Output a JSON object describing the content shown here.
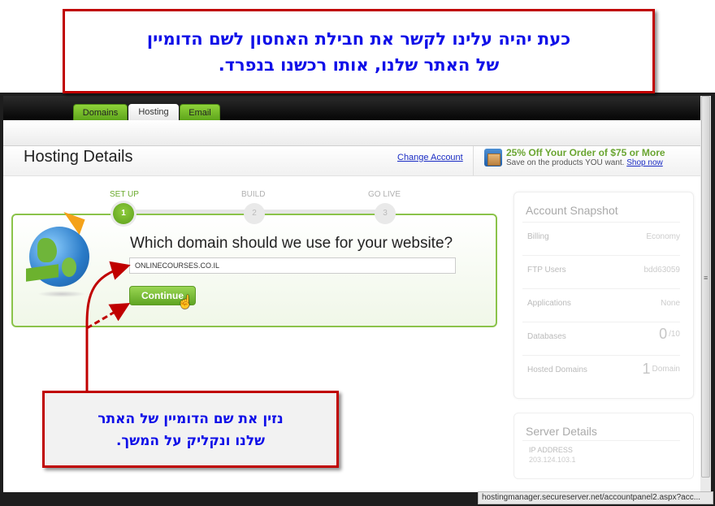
{
  "annotations": {
    "top_callout": [
      "כעת יהיה עלינו לקשר את חבילת האחסון לשם הדומיין",
      "של האתר שלנו, אותו רכשנו בנפרד."
    ],
    "bottom_callout": [
      "נזין את שם הדומיין של האתר",
      "שלנו ונקליק על המשך."
    ],
    "arrow_color": "#c00000",
    "text_color": "#1010e8"
  },
  "nav": {
    "tabs": [
      {
        "label": "Domains",
        "active": false
      },
      {
        "label": "Hosting",
        "active": true
      },
      {
        "label": "Email",
        "active": false
      }
    ]
  },
  "header": {
    "title": "Hosting Details",
    "change_account": "Change Account",
    "promo": {
      "icon": "box-icon",
      "title": "25% Off Your Order of $75 or More",
      "subtitle": "Save on the products YOU want.",
      "link": "Shop now",
      "color": "#6aa531"
    }
  },
  "stepper": {
    "steps": [
      {
        "label": "SET UP",
        "number": "1",
        "active": true
      },
      {
        "label": "BUILD",
        "number": "2",
        "active": false
      },
      {
        "label": "GO LIVE",
        "number": "3",
        "active": false
      }
    ],
    "accent": "#6aaa2c"
  },
  "setup": {
    "question": "Which domain should we use for your website?",
    "domain_value": "ONLINECOURSES.CO.IL",
    "continue_label": "Continue",
    "icon": "globe-icon"
  },
  "snapshot": {
    "title": "Account Snapshot",
    "rows": [
      {
        "label": "Billing",
        "value": "Economy"
      },
      {
        "label": "FTP Users",
        "value": "bdd63059"
      },
      {
        "label": "Applications",
        "value": "None"
      },
      {
        "label": "Databases",
        "big": "0",
        "value": "/10"
      },
      {
        "label": "Hosted Domains",
        "big": "1",
        "value": "Domain"
      }
    ]
  },
  "server": {
    "title": "Server Details",
    "ip_label": "IP ADDRESS",
    "ip_value": "203.124.103.1"
  },
  "statusbar": {
    "url": "hostingmanager.secureserver.net/accountpanel2.aspx?acc..."
  }
}
